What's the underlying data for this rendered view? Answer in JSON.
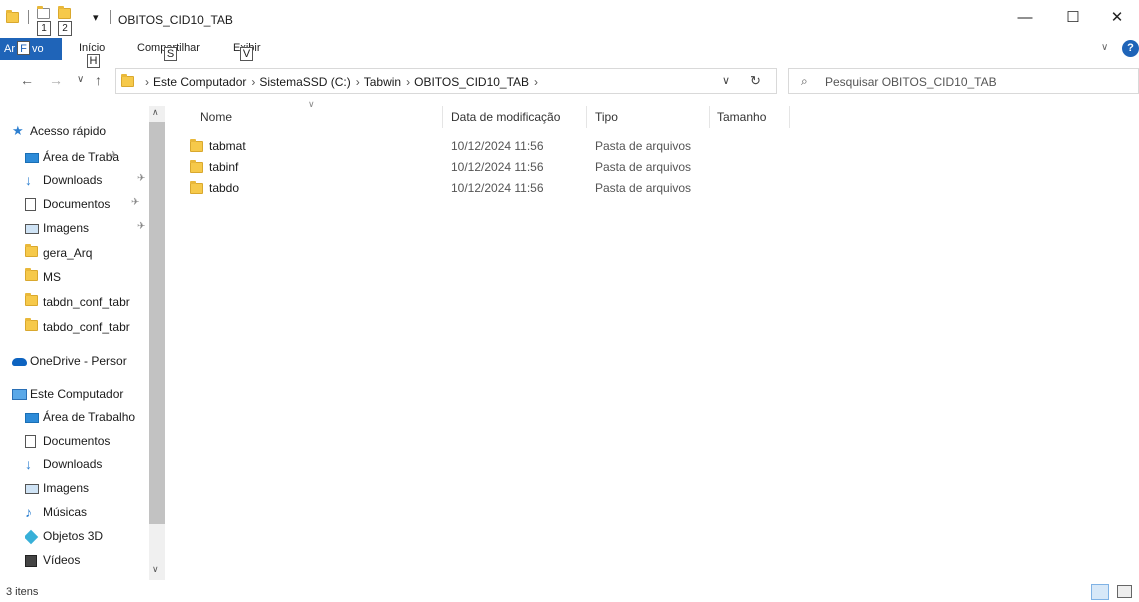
{
  "window": {
    "title": "OBITOS_CID10_TAB",
    "qat_keytip_1": "1",
    "qat_keytip_2": "2",
    "qat_dropdown": "▾",
    "minimize": "—",
    "maximize": "☐",
    "close": "✕"
  },
  "ribbon": {
    "file_label_left": "Ar",
    "file_keytip": "F",
    "file_label_right": "vo",
    "tabs": [
      {
        "label": "Início",
        "keytip": "H"
      },
      {
        "label": "Compartilhar",
        "keytip": "S"
      },
      {
        "label": "Exibir",
        "keytip": "V"
      }
    ],
    "expand": "∨",
    "help": "?"
  },
  "nav": {
    "back": "←",
    "forward": "→",
    "recent": "∨",
    "up": "↑",
    "breadcrumb": [
      "Este Computador",
      "SistemaSSD (C:)",
      "Tabwin",
      "OBITOS_CID10_TAB"
    ],
    "addr_dropdown": "∨",
    "refresh": "↻",
    "search_placeholder": "Pesquisar OBITOS_CID10_TAB"
  },
  "sidebar": {
    "quick_access": "Acesso rápido",
    "quick_items": [
      {
        "label": "Área de Traba",
        "icon": "desktop-icon",
        "pinned": true
      },
      {
        "label": "Downloads",
        "icon": "download-icon",
        "pinned": true
      },
      {
        "label": "Documentos",
        "icon": "documents-icon",
        "pinned": true
      },
      {
        "label": "Imagens",
        "icon": "pictures-icon",
        "pinned": true
      },
      {
        "label": "gera_Arq",
        "icon": "folder-icon",
        "pinned": false
      },
      {
        "label": "MS",
        "icon": "folder-icon",
        "pinned": false
      },
      {
        "label": "tabdn_conf_tabr",
        "icon": "folder-icon",
        "pinned": false
      },
      {
        "label": "tabdo_conf_tabr",
        "icon": "folder-icon",
        "pinned": false
      }
    ],
    "onedrive": "OneDrive - Persor",
    "this_pc": "Este Computador",
    "pc_items": [
      {
        "label": "Área de Trabalho",
        "icon": "desktop-icon"
      },
      {
        "label": "Documentos",
        "icon": "documents-icon"
      },
      {
        "label": "Downloads",
        "icon": "download-icon"
      },
      {
        "label": "Imagens",
        "icon": "pictures-icon"
      },
      {
        "label": "Músicas",
        "icon": "music-icon"
      },
      {
        "label": "Objetos 3D",
        "icon": "3d-objects-icon"
      },
      {
        "label": "Vídeos",
        "icon": "videos-icon"
      }
    ],
    "pin_glyph": "✈",
    "scroll_up": "∧",
    "scroll_down": "∨"
  },
  "columns": {
    "name": "Nome",
    "date": "Data de modificação",
    "type": "Tipo",
    "size": "Tamanho",
    "sort_indicator": "∨"
  },
  "files": [
    {
      "name": "tabmat",
      "date": "10/12/2024 11:56",
      "type": "Pasta de arquivos"
    },
    {
      "name": "tabinf",
      "date": "10/12/2024 11:56",
      "type": "Pasta de arquivos"
    },
    {
      "name": "tabdo",
      "date": "10/12/2024 11:56",
      "type": "Pasta de arquivos"
    }
  ],
  "status": {
    "item_count": "3 itens"
  },
  "colors": {
    "accent": "#1f64b8",
    "folder": "#f6c94a"
  }
}
